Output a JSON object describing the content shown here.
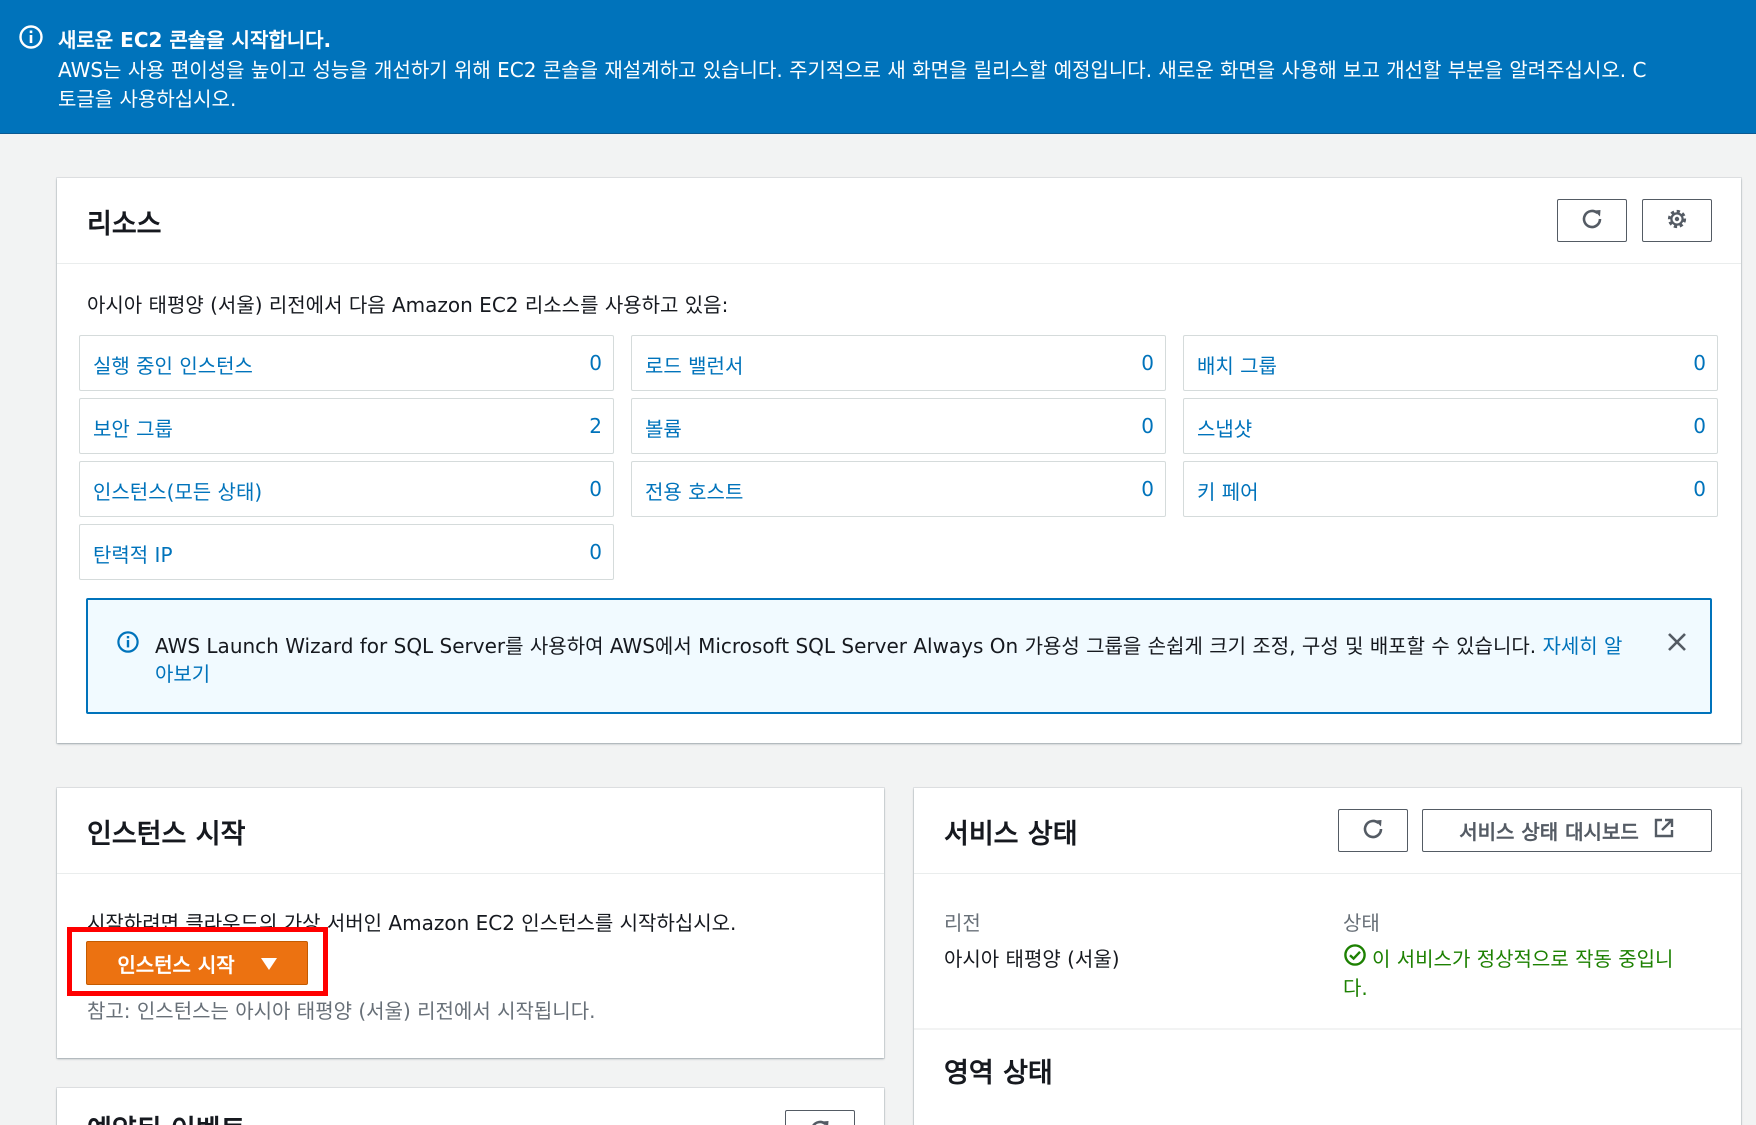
{
  "banner": {
    "title": "새로운 EC2 콘솔을 시작합니다.",
    "line1": "AWS는 사용 편이성을 높이고 성능을 개선하기 위해 EC2 콘솔을 재설계하고 있습니다. 주기적으로 새 화면을 릴리스할 예정입니다. 새로운 화면을 사용해 보고 개선할 부분을 알려주십시오. C",
    "line2": "토글을 사용하십시오."
  },
  "resources": {
    "title": "리소스",
    "intro": "아시아 태평양 (서울) 리전에서 다음 Amazon EC2 리소스를 사용하고 있음:",
    "items": [
      {
        "label": "실행 중인 인스턴스",
        "count": "0"
      },
      {
        "label": "로드 밸런서",
        "count": "0"
      },
      {
        "label": "배치 그룹",
        "count": "0"
      },
      {
        "label": "보안 그룹",
        "count": "2"
      },
      {
        "label": "볼륨",
        "count": "0"
      },
      {
        "label": "스냅샷",
        "count": "0"
      },
      {
        "label": "인스턴스(모든 상태)",
        "count": "0"
      },
      {
        "label": "전용 호스트",
        "count": "0"
      },
      {
        "label": "키 페어",
        "count": "0"
      },
      {
        "label": "탄력적 IP",
        "count": "0"
      }
    ],
    "alert": {
      "text_line1": "AWS Launch Wizard for SQL Server를 사용하여 AWS에서 Microsoft SQL Server Always On 가용성 그룹을 손쉽게 크기 조정, 구성 및 배포할 수 있습니다.",
      "link_part1": "자세히 알",
      "link_part2": "아보기"
    }
  },
  "launch": {
    "title": "인스턴스 시작",
    "desc": "시작하려면 클라우드의 가상 서버인 Amazon EC2 인스턴스를 시작하십시오.",
    "button_label": "인스턴스 시작",
    "note": "참고: 인스턴스는 아시아 태평양 (서울) 리전에서 시작됩니다."
  },
  "service_health": {
    "title": "서비스 상태",
    "dashboard_button": "서비스 상태 대시보드",
    "region_header": "리전",
    "region_value": "아시아 태평양 (서울)",
    "status_header": "상태",
    "status_line1": "이 서비스가 정상적으로 작동 중입니",
    "status_line2": "다.",
    "zone_title": "영역 상태"
  },
  "scheduled_events": {
    "title": "예약된 이벤트"
  },
  "colors": {
    "banner": "#0073bb",
    "link": "#0073bb",
    "primary_button": "#ec7211",
    "success": "#1d8102",
    "highlight": "#ff0000"
  }
}
